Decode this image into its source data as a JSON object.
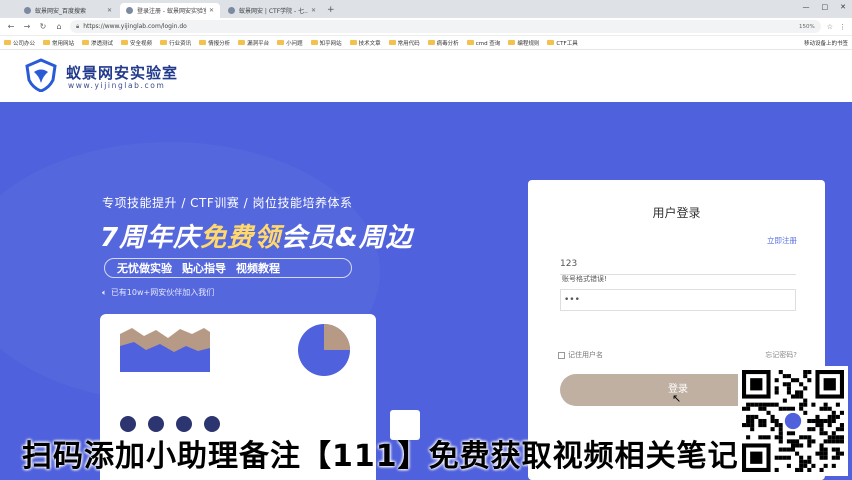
{
  "browser": {
    "tabs": [
      {
        "title": "蚁景网安_百度搜索",
        "active": false
      },
      {
        "title": "登录注册 - 蚁景网安实验室",
        "active": true
      },
      {
        "title": "蚁景网安 | CTF学院 - 七...",
        "active": false
      }
    ],
    "new_tab": "+",
    "url": "https://www.yijinglab.com/login.do",
    "zoom": "150%",
    "window_controls": [
      "—",
      "□",
      "✕"
    ],
    "bookmarks": [
      "公司办公",
      "常用网站",
      "渗透测试",
      "安全视频",
      "行业资讯",
      "情报分析",
      "漏洞平台",
      "小问题",
      "知乎网站",
      "技术文章",
      "常用代码",
      "病毒分析",
      "cmd 查询",
      "编程规则",
      "CTF工具"
    ],
    "bookmarks_right": "移动设备上的书签"
  },
  "site": {
    "logo_title": "蚁景网安实验室",
    "logo_sub": "www.yijinglab.com"
  },
  "hero": {
    "tagline": "专项技能提升 / CTF训赛 / 岗位技能培养体系",
    "title_pre": "7周年庆",
    "title_highlight": "免费领",
    "title_post": "会员&周边",
    "pill_items": [
      "无忧做实验",
      "贴心指导",
      "视频教程"
    ],
    "members": "已有10w+网安伙伴加入我们"
  },
  "login": {
    "title": "用户登录",
    "register": "立即注册",
    "username_value": "123",
    "username_hint": "账号格式错误!",
    "password_value": "•••",
    "remember": "记住用户名",
    "forgot": "忘记密码?",
    "submit": "登录"
  },
  "overlay": {
    "caption": "扫码添加小助理备注【111】免费获取视频相关笔记"
  },
  "colors": {
    "hero_bg": "#4f61dc",
    "logo_blue": "#223a8c",
    "button": "#bfb0a2",
    "highlight": "#ffd86e"
  }
}
